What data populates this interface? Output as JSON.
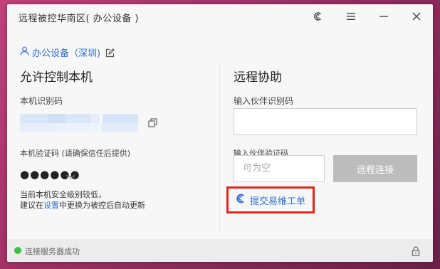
{
  "window": {
    "title": "远程被控华南区( 办公设备 )"
  },
  "icons": {
    "settings": "c-settings-icon",
    "menu": "hamburger-icon",
    "minimize": "minimize-icon",
    "close": "close-icon",
    "user": "user-icon",
    "edit": "edit-icon",
    "copy": "copy-icon",
    "eye_closed": "eye-closed-icon",
    "ticket": "brand-icon",
    "lock": "lock-icon"
  },
  "left": {
    "device_link": "办公设备（深圳)",
    "heading": "允许控制本机",
    "id_label": "本机识别码",
    "verify_label": "本机验证码 (请确保信任后提供)",
    "password_masked": "●●●●●●",
    "note_line1": "当前本机安全级别较低，",
    "note_prefix": "建议在",
    "note_link": "设置",
    "note_suffix": "中更换为被控后自动更新"
  },
  "right": {
    "heading": "远程协助",
    "partner_id_label": "输入伙伴识别码",
    "partner_id_value": "",
    "partner_code_label": "输入伙伴验证码",
    "partner_code_placeholder": "可为空",
    "connect_button": "远程连接",
    "ticket_link": "提交易维工单"
  },
  "status": {
    "text": "连接服务器成功",
    "color": "#3fbf3f"
  },
  "colors": {
    "accent": "#2f6fd6",
    "highlight_border": "#e3241f"
  }
}
